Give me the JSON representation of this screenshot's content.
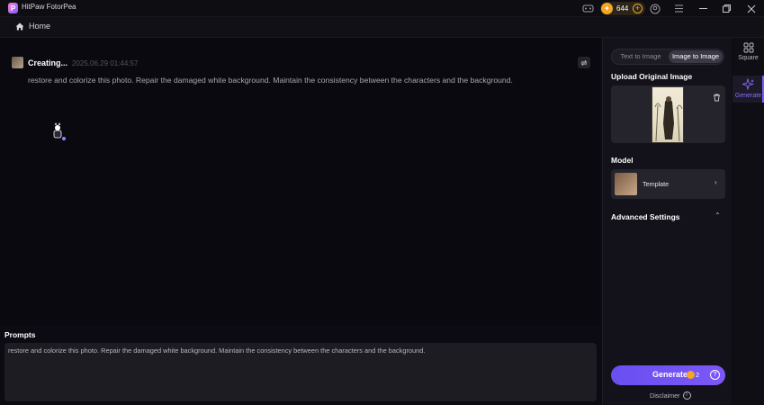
{
  "window": {
    "title": "HitPaw FotorPea",
    "coins": "644"
  },
  "nav": {
    "home": "Home"
  },
  "task": {
    "status": "Creating...",
    "timestamp": "2025.06.29  01:44:57",
    "prompt": "restore and colorize this photo. Repair the damaged white background. Maintain the consistency between the characters and the background."
  },
  "prompts": {
    "label": "Prompts",
    "value": "restore and colorize this photo. Repair the damaged white background. Maintain the consistency between the characters and the background."
  },
  "panel": {
    "tabs": [
      {
        "label": "Text to Image",
        "active": false
      },
      {
        "label": "Image to Image",
        "active": true
      }
    ],
    "upload_title": "Upload Original Image",
    "model_title": "Model",
    "model_name": "Template",
    "advanced_title": "Advanced Settings",
    "generate_label": "Generate",
    "generate_cost": "2",
    "disclaimer": "Disclaimer"
  },
  "rail": {
    "items": [
      {
        "label": "Square",
        "icon": "square-grid-icon"
      },
      {
        "label": "Generate",
        "icon": "sparkle-icon",
        "active": true
      }
    ]
  },
  "colors": {
    "accent": "#7b5cff",
    "coin": "#f5a623",
    "background": "#0b0910"
  }
}
